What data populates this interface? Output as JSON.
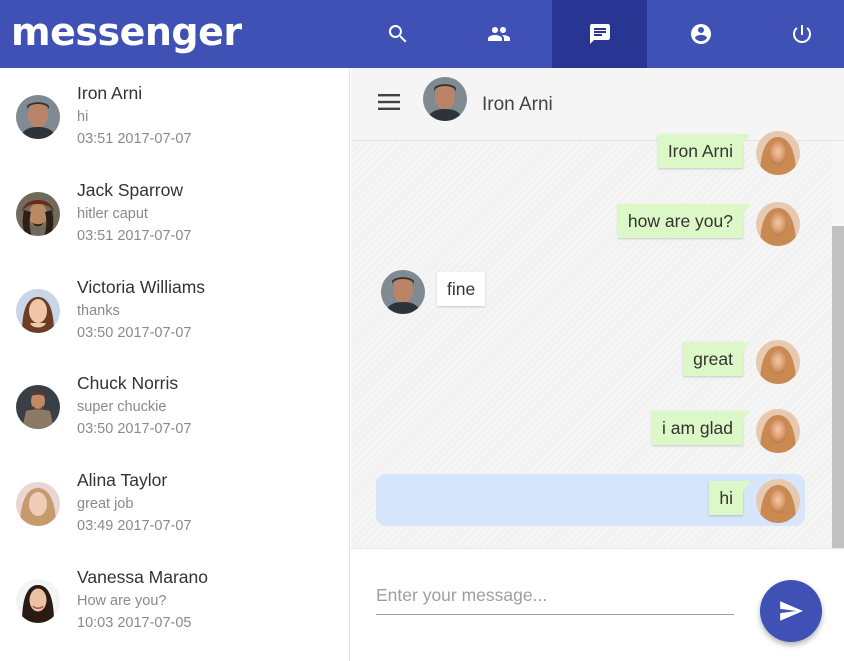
{
  "app": {
    "logo_text": "messenger",
    "brand_color": "#3f51b5",
    "active_color": "#283593"
  },
  "nav": {
    "items": [
      {
        "icon": "search-icon",
        "active": false
      },
      {
        "icon": "people-icon",
        "active": false
      },
      {
        "icon": "chat-icon",
        "active": true
      },
      {
        "icon": "account-icon",
        "active": false
      },
      {
        "icon": "power-icon",
        "active": false
      }
    ]
  },
  "contacts": [
    {
      "name": "Iron Arni",
      "last_message": "hi",
      "time": "03:51 2017-07-07",
      "avatar": "iron-arni"
    },
    {
      "name": "Jack Sparrow",
      "last_message": "hitler caput",
      "time": "03:51 2017-07-07",
      "avatar": "jack-sparrow"
    },
    {
      "name": "Victoria Williams",
      "last_message": "thanks",
      "time": "03:50 2017-07-07",
      "avatar": "victoria-williams"
    },
    {
      "name": "Chuck Norris",
      "last_message": "super chuckie",
      "time": "03:50 2017-07-07",
      "avatar": "chuck-norris"
    },
    {
      "name": "Alina Taylor",
      "last_message": "great job",
      "time": "03:49 2017-07-07",
      "avatar": "alina-taylor"
    },
    {
      "name": "Vanessa Marano",
      "last_message": "How are you?",
      "time": "10:03 2017-07-05",
      "avatar": "vanessa-marano"
    }
  ],
  "chat": {
    "contact_name": "Iron Arni",
    "messages": [
      {
        "text": "Iron Arni",
        "direction": "sent"
      },
      {
        "text": "how are you?",
        "direction": "sent"
      },
      {
        "text": "fine",
        "direction": "received"
      },
      {
        "text": "great",
        "direction": "sent"
      },
      {
        "text": "i am glad",
        "direction": "sent"
      },
      {
        "text": "hi",
        "direction": "sent",
        "highlighted": true
      }
    ]
  },
  "composer": {
    "placeholder": "Enter your message...",
    "value": ""
  },
  "colors": {
    "sent_bubble": "#dcf8c6",
    "received_bubble": "#ffffff",
    "highlight": "#d7e6fb"
  }
}
